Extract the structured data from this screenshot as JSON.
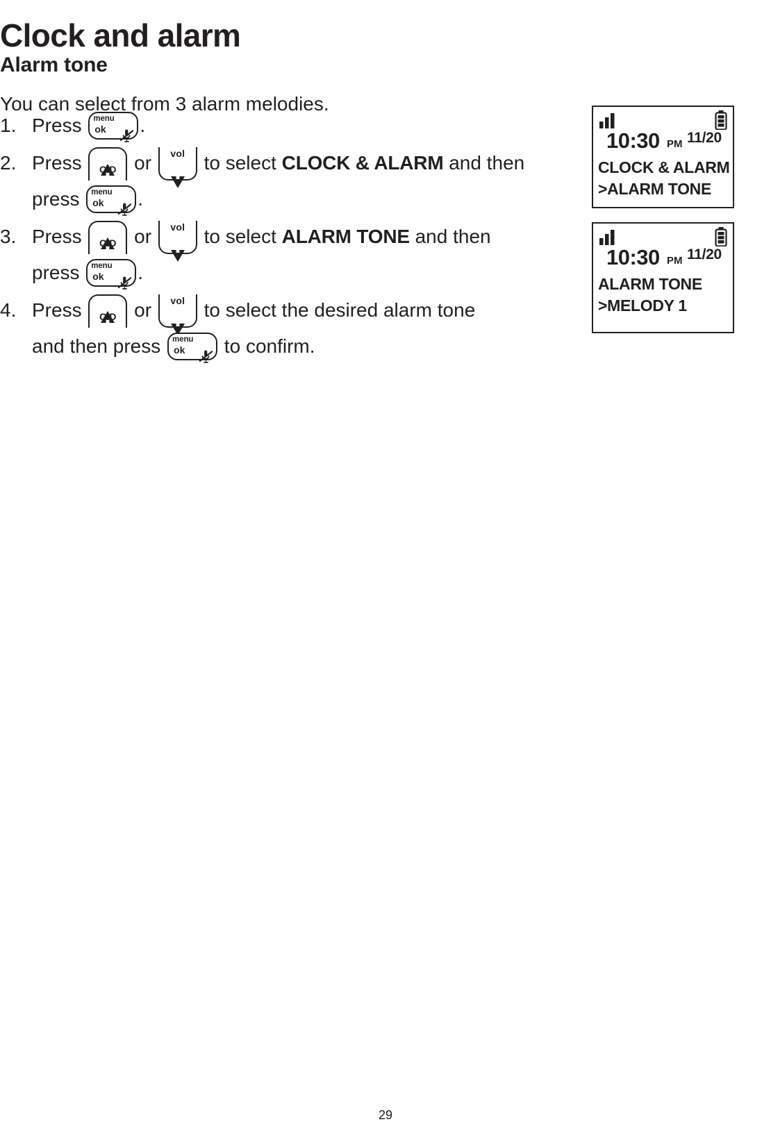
{
  "document": {
    "title": "Clock and alarm",
    "section_title": "Alarm tone",
    "intro": "You can select from 3 alarm melodies.",
    "page_number": "29"
  },
  "keys": {
    "menu_ok": {
      "line1": "menu",
      "line2": "ok",
      "icon": "mute-microphone-icon"
    },
    "cid": {
      "label": "CID",
      "icon": "triangle-up-icon"
    },
    "vol": {
      "label": "vol",
      "icon": "triangle-down-icon"
    }
  },
  "steps": [
    {
      "number": "1.",
      "lines": [
        [
          {
            "t": "text",
            "v": "Press "
          },
          {
            "t": "key",
            "v": "menu_ok"
          },
          {
            "t": "text",
            "v": "."
          }
        ]
      ]
    },
    {
      "number": "2.",
      "lines": [
        [
          {
            "t": "text",
            "v": "Press "
          },
          {
            "t": "key",
            "v": "cid"
          },
          {
            "t": "text",
            "v": " or "
          },
          {
            "t": "key",
            "v": "vol"
          },
          {
            "t": "text",
            "v": " to select "
          },
          {
            "t": "bold",
            "v": "CLOCK & ALARM"
          },
          {
            "t": "text",
            "v": " and then"
          }
        ],
        [
          {
            "t": "text",
            "v": "press "
          },
          {
            "t": "key",
            "v": "menu_ok"
          },
          {
            "t": "text",
            "v": "."
          }
        ]
      ]
    },
    {
      "number": "3.",
      "lines": [
        [
          {
            "t": "text",
            "v": "Press "
          },
          {
            "t": "key",
            "v": "cid"
          },
          {
            "t": "text",
            "v": " or "
          },
          {
            "t": "key",
            "v": "vol"
          },
          {
            "t": "text",
            "v": " to select "
          },
          {
            "t": "bold",
            "v": "ALARM TONE"
          },
          {
            "t": "text",
            "v": " and then"
          }
        ],
        [
          {
            "t": "text",
            "v": "press "
          },
          {
            "t": "key",
            "v": "menu_ok"
          },
          {
            "t": "text",
            "v": "."
          }
        ]
      ]
    },
    {
      "number": "4.",
      "lines": [
        [
          {
            "t": "text",
            "v": "Press "
          },
          {
            "t": "key",
            "v": "cid"
          },
          {
            "t": "text",
            "v": " or "
          },
          {
            "t": "key",
            "v": "vol"
          },
          {
            "t": "text",
            "v": " to select the desired alarm tone"
          }
        ],
        [
          {
            "t": "text",
            "v": "and then press "
          },
          {
            "t": "key",
            "v": "menu_ok"
          },
          {
            "t": "text",
            "v": " to confirm."
          }
        ]
      ]
    }
  ],
  "displays": [
    {
      "name": "clock-and-alarm-screen",
      "signal_icon": "signal-bars-icon",
      "battery_icon": "battery-full-icon",
      "time": "10:30",
      "ampm": "PM",
      "date": "11/20",
      "line1": "CLOCK & ALARM",
      "line2": ">ALARM TONE"
    },
    {
      "name": "alarm-tone-screen",
      "signal_icon": "signal-bars-icon",
      "battery_icon": "battery-full-icon",
      "time": "10:30",
      "ampm": "PM",
      "date": "11/20",
      "line1": "ALARM TONE",
      "line2": ">MELODY 1"
    }
  ],
  "colors": {
    "ink": "#231f20",
    "paper": "#ffffff"
  }
}
